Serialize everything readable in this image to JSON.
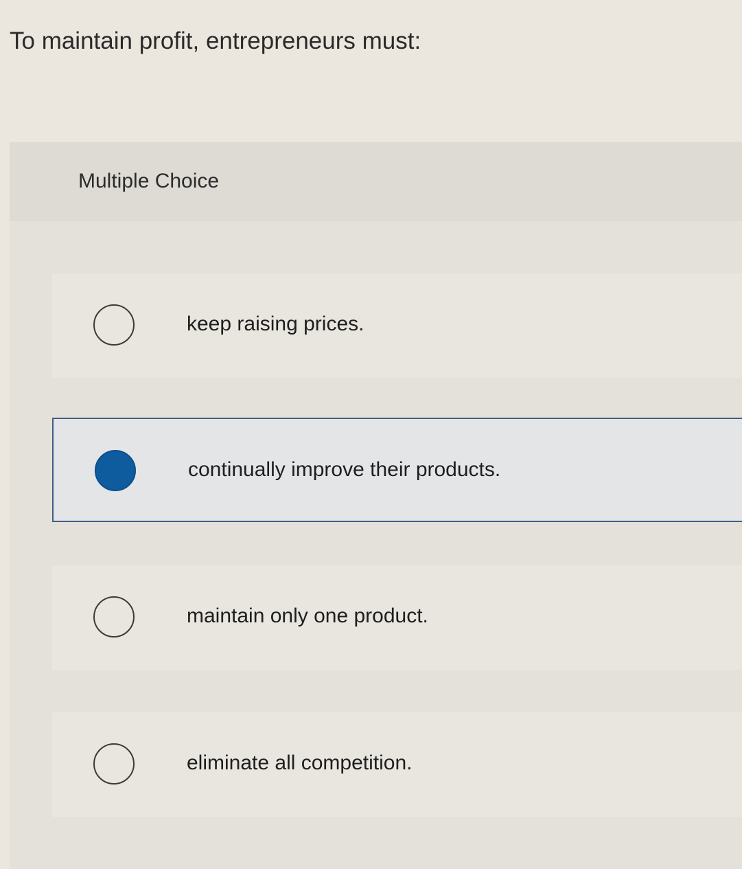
{
  "question": {
    "text": "To maintain profit, entrepreneurs must:"
  },
  "panel": {
    "label": "Multiple Choice",
    "options": [
      {
        "text": "keep raising prices.",
        "selected": false,
        "radio_icon": "radio-unselected-icon"
      },
      {
        "text": "continually improve their products.",
        "selected": true,
        "radio_icon": "radio-selected-icon"
      },
      {
        "text": "maintain only one product.",
        "selected": false,
        "radio_icon": "radio-unselected-icon"
      },
      {
        "text": "eliminate all competition.",
        "selected": false,
        "radio_icon": "radio-unselected-icon"
      }
    ]
  },
  "colors": {
    "accent": "#0e5b9e",
    "selected_border": "#3f5f86",
    "background": "#ebe7de"
  }
}
